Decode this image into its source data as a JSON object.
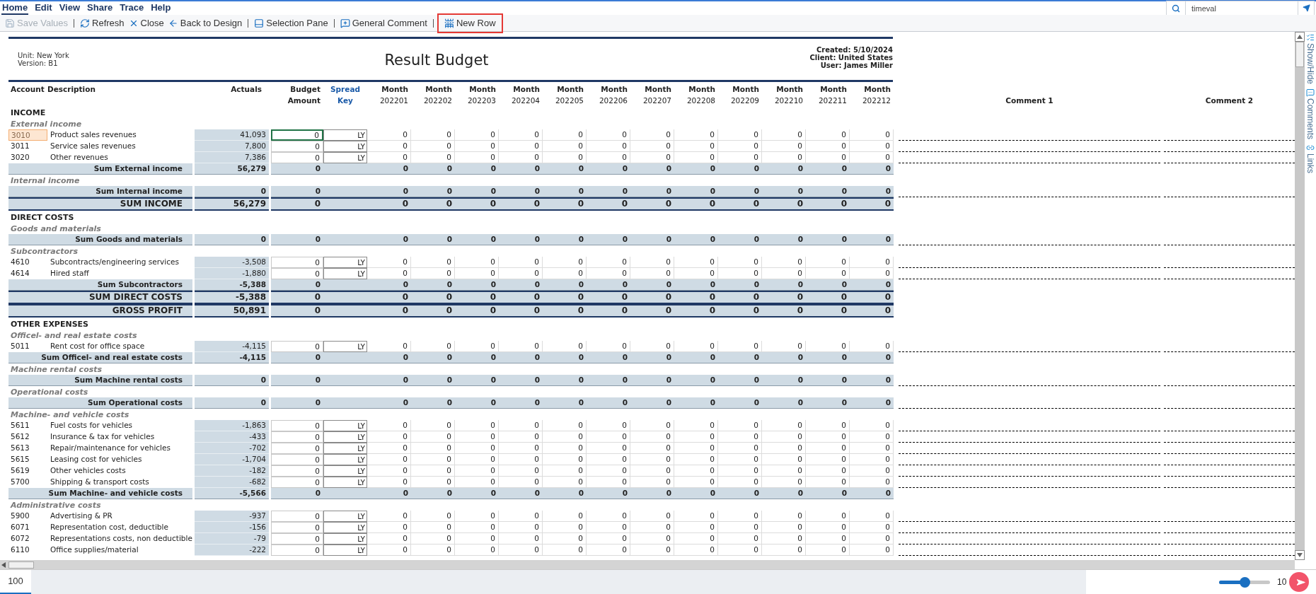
{
  "menu": [
    {
      "label": "Home",
      "selected": true
    },
    {
      "label": "Edit",
      "selected": false
    },
    {
      "label": "View",
      "selected": false
    },
    {
      "label": "Share",
      "selected": false
    },
    {
      "label": "Trace",
      "selected": false
    },
    {
      "label": "Help",
      "selected": false
    }
  ],
  "search": {
    "value": "timeval"
  },
  "toolbar": [
    {
      "kind": "save",
      "label": "Save Values",
      "disabled": true,
      "highlighted": false
    },
    {
      "kind": "separator"
    },
    {
      "kind": "refresh",
      "label": "Refresh",
      "disabled": false,
      "highlighted": false
    },
    {
      "kind": "close",
      "label": "Close",
      "disabled": false,
      "highlighted": false
    },
    {
      "kind": "back",
      "label": "Back to Design",
      "disabled": false,
      "highlighted": false
    },
    {
      "kind": "separator"
    },
    {
      "kind": "pane",
      "label": "Selection Pane",
      "disabled": false,
      "highlighted": false
    },
    {
      "kind": "separator"
    },
    {
      "kind": "comment",
      "label": "General Comment",
      "disabled": false,
      "highlighted": false
    },
    {
      "kind": "separator"
    },
    {
      "kind": "newrow",
      "label": "New Row",
      "disabled": false,
      "highlighted": true
    }
  ],
  "report": {
    "unit": "Unit: New York",
    "version": "Version: B1",
    "title": "Result Budget",
    "created": "Created: 5/10/2024",
    "client": "Client: United States",
    "user": "User: James Miller"
  },
  "columns": {
    "account": "Account",
    "description": "Description",
    "actuals": "Actuals",
    "budget": [
      "Budget",
      "Amount"
    ],
    "spread_key": [
      "Spread",
      "Key"
    ],
    "months": [
      [
        "Month",
        "202201"
      ],
      [
        "Month",
        "202202"
      ],
      [
        "Month",
        "202203"
      ],
      [
        "Month",
        "202204"
      ],
      [
        "Month",
        "202205"
      ],
      [
        "Month",
        "202206"
      ],
      [
        "Month",
        "202207"
      ],
      [
        "Month",
        "202208"
      ],
      [
        "Month",
        "202209"
      ],
      [
        "Month",
        "202210"
      ],
      [
        "Month",
        "202211"
      ],
      [
        "Month",
        "202212"
      ]
    ],
    "comments": [
      "Comment 1",
      "Comment 2"
    ]
  },
  "rows": [
    {
      "kind": "section",
      "label": "INCOME"
    },
    {
      "kind": "group",
      "label": "External income"
    },
    {
      "kind": "line",
      "account": "3010",
      "description": "Product sales revenues",
      "actuals": "41,093",
      "budget": "0",
      "key": "LY",
      "months": [
        "0",
        "0",
        "0",
        "0",
        "0",
        "0",
        "0",
        "0",
        "0",
        "0",
        "0",
        "0"
      ],
      "selected": true
    },
    {
      "kind": "line",
      "account": "3011",
      "description": "Service sales revenues",
      "actuals": "7,800",
      "budget": "0",
      "key": "LY",
      "months": [
        "0",
        "0",
        "0",
        "0",
        "0",
        "0",
        "0",
        "0",
        "0",
        "0",
        "0",
        "0"
      ],
      "selected": false
    },
    {
      "kind": "line",
      "account": "3020",
      "description": "Other revenues",
      "actuals": "7,386",
      "budget": "0",
      "key": "LY",
      "months": [
        "0",
        "0",
        "0",
        "0",
        "0",
        "0",
        "0",
        "0",
        "0",
        "0",
        "0",
        "0"
      ],
      "selected": false
    },
    {
      "kind": "sum",
      "label": "Sum External income",
      "actuals": "56,279",
      "budget": "0",
      "months": [
        "0",
        "0",
        "0",
        "0",
        "0",
        "0",
        "0",
        "0",
        "0",
        "0",
        "0",
        "0"
      ],
      "comment_fields": false
    },
    {
      "kind": "group",
      "label": "Internal income"
    },
    {
      "kind": "sum",
      "label": "Sum Internal income",
      "actuals": "0",
      "budget": "0",
      "months": [
        "0",
        "0",
        "0",
        "0",
        "0",
        "0",
        "0",
        "0",
        "0",
        "0",
        "0",
        "0"
      ],
      "comment_fields": true
    },
    {
      "kind": "total",
      "label": "SUM INCOME",
      "actuals": "56,279",
      "budget": "0",
      "months": [
        "0",
        "0",
        "0",
        "0",
        "0",
        "0",
        "0",
        "0",
        "0",
        "0",
        "0",
        "0"
      ]
    },
    {
      "kind": "section",
      "label": "DIRECT COSTS"
    },
    {
      "kind": "group",
      "label": "Goods and materials"
    },
    {
      "kind": "sum",
      "label": "Sum Goods and materials",
      "actuals": "0",
      "budget": "0",
      "months": [
        "0",
        "0",
        "0",
        "0",
        "0",
        "0",
        "0",
        "0",
        "0",
        "0",
        "0",
        "0"
      ],
      "comment_fields": true
    },
    {
      "kind": "group",
      "label": "Subcontractors"
    },
    {
      "kind": "line",
      "account": "4610",
      "description": "Subcontracts/engineering services",
      "actuals": "-3,508",
      "budget": "0",
      "key": "LY",
      "months": [
        "0",
        "0",
        "0",
        "0",
        "0",
        "0",
        "0",
        "0",
        "0",
        "0",
        "0",
        "0"
      ],
      "selected": false
    },
    {
      "kind": "line",
      "account": "4614",
      "description": "Hired staff",
      "actuals": "-1,880",
      "budget": "0",
      "key": "LY",
      "months": [
        "0",
        "0",
        "0",
        "0",
        "0",
        "0",
        "0",
        "0",
        "0",
        "0",
        "0",
        "0"
      ],
      "selected": false
    },
    {
      "kind": "sum",
      "label": "Sum Subcontractors",
      "actuals": "-5,388",
      "budget": "0",
      "months": [
        "0",
        "0",
        "0",
        "0",
        "0",
        "0",
        "0",
        "0",
        "0",
        "0",
        "0",
        "0"
      ],
      "comment_fields": false
    },
    {
      "kind": "total",
      "label": "SUM DIRECT COSTS",
      "actuals": "-5,388",
      "budget": "0",
      "months": [
        "0",
        "0",
        "0",
        "0",
        "0",
        "0",
        "0",
        "0",
        "0",
        "0",
        "0",
        "0"
      ]
    },
    {
      "kind": "total",
      "label": "GROSS PROFIT",
      "actuals": "50,891",
      "budget": "0",
      "months": [
        "0",
        "0",
        "0",
        "0",
        "0",
        "0",
        "0",
        "0",
        "0",
        "0",
        "0",
        "0"
      ]
    },
    {
      "kind": "section",
      "label": "OTHER EXPENSES"
    },
    {
      "kind": "group",
      "label": "Officel- and real estate costs"
    },
    {
      "kind": "line",
      "account": "5011",
      "description": "Rent cost for office space",
      "actuals": "-4,115",
      "budget": "0",
      "key": "LY",
      "months": [
        "0",
        "0",
        "0",
        "0",
        "0",
        "0",
        "0",
        "0",
        "0",
        "0",
        "0",
        "0"
      ],
      "selected": false
    },
    {
      "kind": "sum",
      "label": "Sum Officel- and real estate costs",
      "actuals": "-4,115",
      "budget": "0",
      "months": [
        "0",
        "0",
        "0",
        "0",
        "0",
        "0",
        "0",
        "0",
        "0",
        "0",
        "0",
        "0"
      ],
      "comment_fields": false
    },
    {
      "kind": "group",
      "label": "Machine rental costs"
    },
    {
      "kind": "sum",
      "label": "Sum Machine rental costs",
      "actuals": "0",
      "budget": "0",
      "months": [
        "0",
        "0",
        "0",
        "0",
        "0",
        "0",
        "0",
        "0",
        "0",
        "0",
        "0",
        "0"
      ],
      "comment_fields": true
    },
    {
      "kind": "group",
      "label": "Operational costs"
    },
    {
      "kind": "sum",
      "label": "Sum Operational costs",
      "actuals": "0",
      "budget": "0",
      "months": [
        "0",
        "0",
        "0",
        "0",
        "0",
        "0",
        "0",
        "0",
        "0",
        "0",
        "0",
        "0"
      ],
      "comment_fields": true
    },
    {
      "kind": "group",
      "label": "Machine- and vehicle costs"
    },
    {
      "kind": "line",
      "account": "5611",
      "description": "Fuel costs for vehicles",
      "actuals": "-1,863",
      "budget": "0",
      "key": "LY",
      "months": [
        "0",
        "0",
        "0",
        "0",
        "0",
        "0",
        "0",
        "0",
        "0",
        "0",
        "0",
        "0"
      ],
      "selected": false
    },
    {
      "kind": "line",
      "account": "5612",
      "description": "Insurance & tax for vehicles",
      "actuals": "-433",
      "budget": "0",
      "key": "LY",
      "months": [
        "0",
        "0",
        "0",
        "0",
        "0",
        "0",
        "0",
        "0",
        "0",
        "0",
        "0",
        "0"
      ],
      "selected": false
    },
    {
      "kind": "line",
      "account": "5613",
      "description": "Repair/maintenance for vehicles",
      "actuals": "-702",
      "budget": "0",
      "key": "LY",
      "months": [
        "0",
        "0",
        "0",
        "0",
        "0",
        "0",
        "0",
        "0",
        "0",
        "0",
        "0",
        "0"
      ],
      "selected": false
    },
    {
      "kind": "line",
      "account": "5615",
      "description": "Leasing cost for vehicles",
      "actuals": "-1,704",
      "budget": "0",
      "key": "LY",
      "months": [
        "0",
        "0",
        "0",
        "0",
        "0",
        "0",
        "0",
        "0",
        "0",
        "0",
        "0",
        "0"
      ],
      "selected": false
    },
    {
      "kind": "line",
      "account": "5619",
      "description": "Other vehicles costs",
      "actuals": "-182",
      "budget": "0",
      "key": "LY",
      "months": [
        "0",
        "0",
        "0",
        "0",
        "0",
        "0",
        "0",
        "0",
        "0",
        "0",
        "0",
        "0"
      ],
      "selected": false
    },
    {
      "kind": "line",
      "account": "5700",
      "description": "Shipping & transport costs",
      "actuals": "-682",
      "budget": "0",
      "key": "LY",
      "months": [
        "0",
        "0",
        "0",
        "0",
        "0",
        "0",
        "0",
        "0",
        "0",
        "0",
        "0",
        "0"
      ],
      "selected": false
    },
    {
      "kind": "sum",
      "label": "Sum Machine- and vehicle costs",
      "actuals": "-5,566",
      "budget": "0",
      "months": [
        "0",
        "0",
        "0",
        "0",
        "0",
        "0",
        "0",
        "0",
        "0",
        "0",
        "0",
        "0"
      ],
      "comment_fields": false
    },
    {
      "kind": "group",
      "label": "Administrative costs"
    },
    {
      "kind": "line",
      "account": "5900",
      "description": "Advertising & PR",
      "actuals": "-937",
      "budget": "0",
      "key": "LY",
      "months": [
        "0",
        "0",
        "0",
        "0",
        "0",
        "0",
        "0",
        "0",
        "0",
        "0",
        "0",
        "0"
      ],
      "selected": false
    },
    {
      "kind": "line",
      "account": "6071",
      "description": "Representation cost, deductible",
      "actuals": "-156",
      "budget": "0",
      "key": "LY",
      "months": [
        "0",
        "0",
        "0",
        "0",
        "0",
        "0",
        "0",
        "0",
        "0",
        "0",
        "0",
        "0"
      ],
      "selected": false
    },
    {
      "kind": "line",
      "account": "6072",
      "description": "Representations costs, non deductible",
      "actuals": "-79",
      "budget": "0",
      "key": "LY",
      "months": [
        "0",
        "0",
        "0",
        "0",
        "0",
        "0",
        "0",
        "0",
        "0",
        "0",
        "0",
        "0"
      ],
      "selected": false
    },
    {
      "kind": "line",
      "account": "6110",
      "description": "Office supplies/material",
      "actuals": "-222",
      "budget": "0",
      "key": "LY",
      "months": [
        "0",
        "0",
        "0",
        "0",
        "0",
        "0",
        "0",
        "0",
        "0",
        "0",
        "0",
        "0"
      ],
      "selected": false
    }
  ],
  "side_tabs": [
    {
      "kind": "showhide",
      "label": "Show/Hide"
    },
    {
      "kind": "comments",
      "label": "Comments"
    },
    {
      "kind": "links",
      "label": "Links"
    }
  ],
  "status": {
    "tab": {
      "label": "100",
      "selected": true
    },
    "zoom": {
      "level": 0.5,
      "text": "10"
    }
  }
}
